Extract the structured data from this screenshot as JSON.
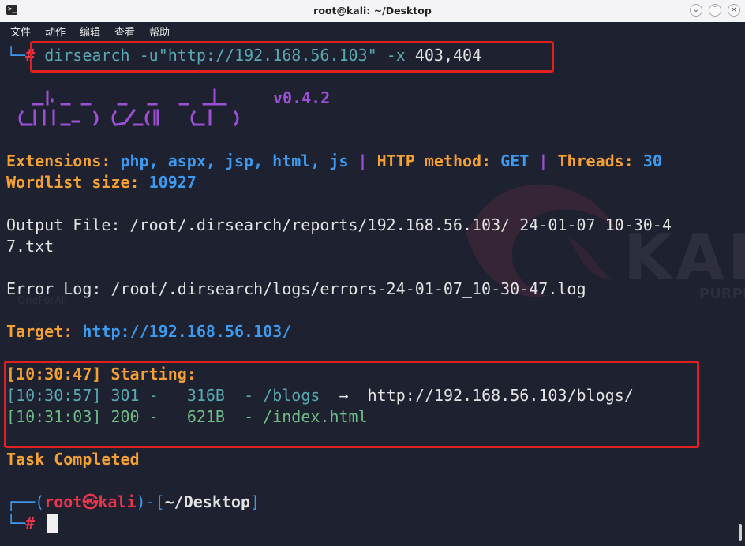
{
  "window": {
    "title": "root@kali: ~/Desktop",
    "terminal_icon": "terminal-icon",
    "controls": [
      "minimize-icon",
      "maximize-icon",
      "close-icon"
    ]
  },
  "menu": [
    {
      "label": "文件"
    },
    {
      "label": "动作"
    },
    {
      "label": "编辑"
    },
    {
      "label": "查看"
    },
    {
      "label": "帮助"
    }
  ],
  "colors": {
    "highlight_box": "#e32020",
    "orange": "#f5a033",
    "blue": "#3c9bf0",
    "purple": "#9d4fd6",
    "cyan": "#57a9b2",
    "green": "#6dbc86",
    "red": "#e8354a",
    "background": "#1e2130"
  },
  "command": {
    "prefix": "└─",
    "prompt": "#",
    "program": "dirsearch",
    "flag_u": "-u",
    "url": "\"http://192.168.56.103\"",
    "flag_x": "-x",
    "codes": "403,404"
  },
  "banner": {
    "version": "v0.4.2",
    "logo_text": "dirsearch"
  },
  "info": {
    "extensions_label": "Extensions:",
    "extensions": "php, aspx, jsp, html, js",
    "sep": "|",
    "method_label": "HTTP method:",
    "method": "GET",
    "threads_label": "Threads:",
    "threads": "30",
    "wordlist_label": "Wordlist size:",
    "wordlist_size": "10927"
  },
  "output_file": {
    "line1": "Output File: /root/.dirsearch/reports/192.168.56.103/_24-01-07_10-30-4",
    "line2": "7.txt"
  },
  "error_log": "Error Log: /root/.dirsearch/logs/errors-24-01-07_10-30-47.log",
  "target": {
    "label": "Target:",
    "url": "http://192.168.56.103/"
  },
  "scan": {
    "start_time": "[10:30:47]",
    "start_label": "Starting:",
    "results": [
      {
        "time": "[10:30:57]",
        "status": "301",
        "dash": "-",
        "size": "316B",
        "path": "- /blogs",
        "arrow": "→",
        "redirect": "http://192.168.56.103/blogs/"
      },
      {
        "time": "[10:31:03]",
        "status": "200",
        "dash": "-",
        "size": "621B",
        "path": "- /index.html",
        "arrow": "",
        "redirect": ""
      }
    ]
  },
  "completed": "Task Completed",
  "prompt": {
    "top_left": "┌──(",
    "user": "root",
    "at": "㉿",
    "host": "kali",
    "mid": ")-[",
    "cwd": "~/Desktop",
    "end": "]",
    "bottom": "└─",
    "hash": "#"
  },
  "background": {
    "watermark": "KALI",
    "watermark_sub": "PURPL",
    "desktop_label": "OneForAll-"
  }
}
